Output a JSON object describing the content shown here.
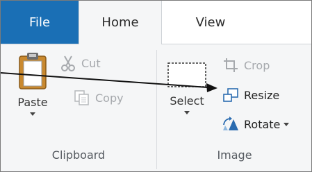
{
  "tabs": {
    "file": "File",
    "home": "Home",
    "view": "View"
  },
  "clipboard": {
    "paste_label": "Paste",
    "cut_label": "Cut",
    "copy_label": "Copy",
    "group_label": "Clipboard"
  },
  "image": {
    "select_label": "Select",
    "crop_label": "Crop",
    "resize_label": "Resize",
    "rotate_label": "Rotate",
    "group_label": "Image"
  },
  "colors": {
    "file_tab": "#1a6fb5",
    "ribbon_bg": "#f5f6f7",
    "disabled_text": "#a6a9ad"
  }
}
